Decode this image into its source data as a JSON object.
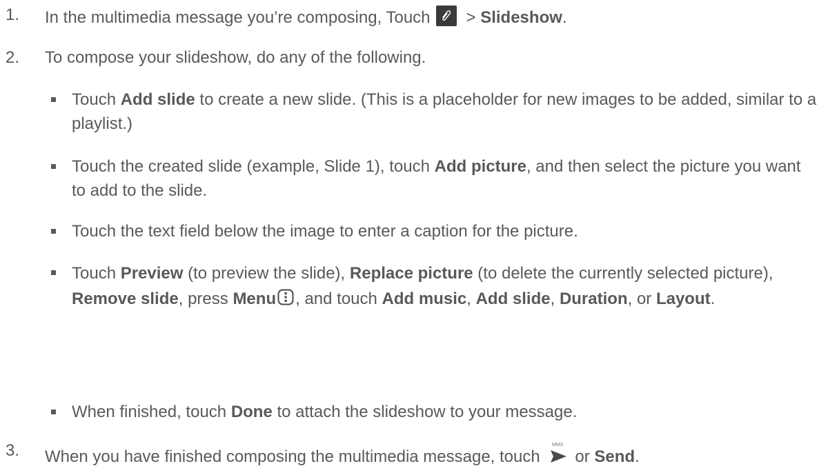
{
  "step1": {
    "num": "1.",
    "before": "In the multimedia message you’re composing, Touch",
    "gt": "> ",
    "bold": "Slideshow",
    "after": "."
  },
  "step2": {
    "num": "2.",
    "text": "To compose your slideshow, do any of the following."
  },
  "b1": {
    "t1": "Touch ",
    "b1": "Add slide",
    "t2": " to create a new slide. (This is a placeholder for new images to be added, similar to a playlist.)"
  },
  "b2": {
    "t1": "Touch the created slide (example, Slide 1), touch ",
    "b1": "Add picture",
    "t2": ", and then select the picture you want to add to the slide."
  },
  "b3": {
    "t1": "Touch the text field below the image to enter a caption for the picture."
  },
  "b4": {
    "t1": "Touch ",
    "b1": "Preview",
    "t2": " (to preview the slide), ",
    "b2": "Replace picture",
    "t3": " (to delete the currently selected picture), ",
    "b3": "Remove slide",
    "t4": ", press ",
    "b4": "Menu",
    "t5": ", and touch ",
    "b5": "Add music",
    "t6": ", ",
    "b6": "Add slide",
    "t7": ", ",
    "b7": "Duration",
    "t8": ", or ",
    "b8": "Layout",
    "t9": "."
  },
  "b5": {
    "t1": "When finished, touch ",
    "b1": "Done",
    "t2": " to attach the slideshow to your message."
  },
  "step3": {
    "num": "3.",
    "before": "When you have finished composing the multimedia message, touch",
    "or": " or ",
    "bold": "Send",
    "after": ".",
    "send_icon_label": "MMS"
  },
  "icons": {
    "attach": "paperclip-icon",
    "menu": "menu-key-icon",
    "send": "send-mms-icon"
  }
}
